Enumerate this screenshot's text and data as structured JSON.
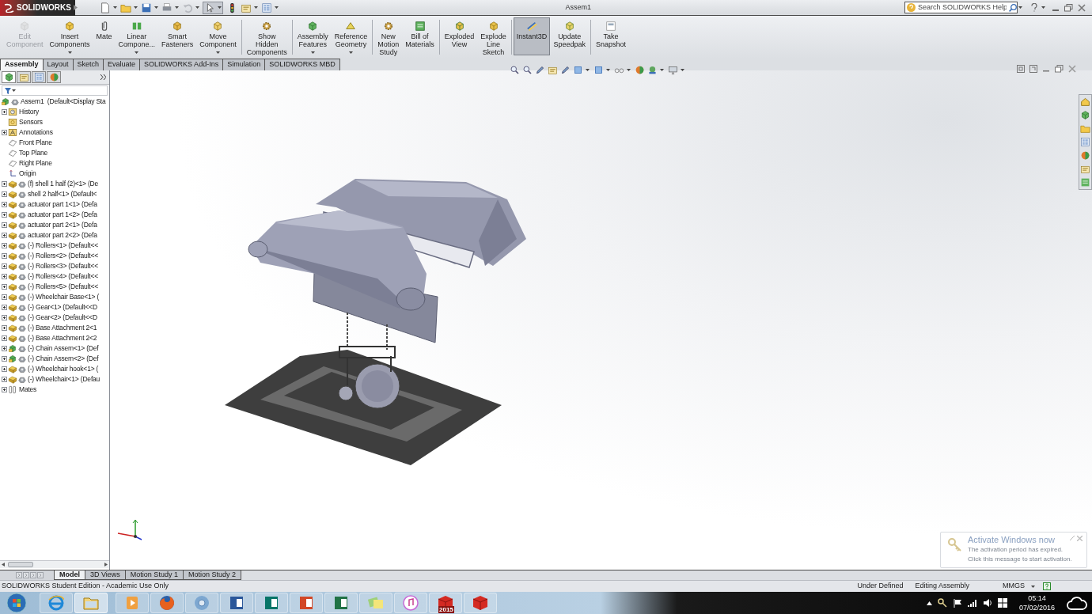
{
  "app": {
    "logo": "SOLIDWORKS",
    "title": "Assem1"
  },
  "search": {
    "placeholder": "Search SOLIDWORKS Help"
  },
  "commands": [
    {
      "lines": [
        "Edit",
        "Component"
      ],
      "disabled": true,
      "dropdown": false,
      "selected": false,
      "separator_before": false
    },
    {
      "lines": [
        "Insert",
        "Components"
      ],
      "disabled": false,
      "dropdown": true,
      "selected": false,
      "separator_before": false
    },
    {
      "lines": [
        "Mate"
      ],
      "disabled": false,
      "dropdown": false,
      "selected": false,
      "separator_before": false
    },
    {
      "lines": [
        "Linear",
        "Compone..."
      ],
      "disabled": false,
      "dropdown": true,
      "selected": false,
      "separator_before": false
    },
    {
      "lines": [
        "Smart",
        "Fasteners"
      ],
      "disabled": false,
      "dropdown": false,
      "selected": false,
      "separator_before": false
    },
    {
      "lines": [
        "Move",
        "Component"
      ],
      "disabled": false,
      "dropdown": true,
      "selected": false,
      "separator_before": false
    },
    {
      "lines": [
        "Show",
        "Hidden",
        "Components"
      ],
      "disabled": false,
      "dropdown": false,
      "selected": false,
      "separator_before": true
    },
    {
      "lines": [
        "Assembly",
        "Features"
      ],
      "disabled": false,
      "dropdown": true,
      "selected": false,
      "separator_before": true
    },
    {
      "lines": [
        "Reference",
        "Geometry"
      ],
      "disabled": false,
      "dropdown": true,
      "selected": false,
      "separator_before": false
    },
    {
      "lines": [
        "New",
        "Motion",
        "Study"
      ],
      "disabled": false,
      "dropdown": false,
      "selected": false,
      "separator_before": true
    },
    {
      "lines": [
        "Bill of",
        "Materials"
      ],
      "disabled": false,
      "dropdown": false,
      "selected": false,
      "separator_before": false
    },
    {
      "lines": [
        "Exploded",
        "View"
      ],
      "disabled": false,
      "dropdown": false,
      "selected": false,
      "separator_before": true
    },
    {
      "lines": [
        "Explode",
        "Line",
        "Sketch"
      ],
      "disabled": false,
      "dropdown": false,
      "selected": false,
      "separator_before": false
    },
    {
      "lines": [
        "Instant3D"
      ],
      "disabled": false,
      "dropdown": false,
      "selected": true,
      "separator_before": true
    },
    {
      "lines": [
        "Update",
        "Speedpak"
      ],
      "disabled": false,
      "dropdown": false,
      "selected": false,
      "separator_before": false
    },
    {
      "lines": [
        "Take",
        "Snapshot"
      ],
      "disabled": false,
      "dropdown": false,
      "selected": false,
      "separator_before": true
    }
  ],
  "tabs": [
    {
      "label": "Assembly",
      "selected": true
    },
    {
      "label": "Layout",
      "selected": false
    },
    {
      "label": "Sketch",
      "selected": false
    },
    {
      "label": "Evaluate",
      "selected": false
    },
    {
      "label": "SOLIDWORKS Add-Ins",
      "selected": false
    },
    {
      "label": "Simulation",
      "selected": false
    },
    {
      "label": "SOLIDWORKS MBD",
      "selected": false
    }
  ],
  "tree": {
    "label": "Assem1  (Default<Display Sta",
    "kind": "assembly",
    "children": [
      {
        "label": "History",
        "kind": "history",
        "expandable": true
      },
      {
        "label": "Sensors",
        "kind": "sensors",
        "expandable": false
      },
      {
        "label": "Annotations",
        "kind": "annotations",
        "expandable": true
      },
      {
        "label": "Front Plane",
        "kind": "plane",
        "expandable": false
      },
      {
        "label": "Top Plane",
        "kind": "plane",
        "expandable": false
      },
      {
        "label": "Right Plane",
        "kind": "plane",
        "expandable": false
      },
      {
        "label": "Origin",
        "kind": "origin",
        "expandable": false
      },
      {
        "label": "(f) shell 1 half (2)<1> (De",
        "kind": "part",
        "expandable": true
      },
      {
        "label": "shell 2 half<1> (Default<",
        "kind": "part",
        "expandable": true
      },
      {
        "label": "actuator part 1<1> (Defa",
        "kind": "part",
        "expandable": true
      },
      {
        "label": "actuator part 1<2> (Defa",
        "kind": "part",
        "expandable": true
      },
      {
        "label": "actuator part 2<1> (Defa",
        "kind": "part",
        "expandable": true
      },
      {
        "label": "actuator part 2<2> (Defa",
        "kind": "part",
        "expandable": true
      },
      {
        "label": "(-) Rollers<1> (Default<<",
        "kind": "part",
        "expandable": true
      },
      {
        "label": "(-) Rollers<2> (Default<<",
        "kind": "part",
        "expandable": true
      },
      {
        "label": "(-) Rollers<3> (Default<<",
        "kind": "part",
        "expandable": true
      },
      {
        "label": "(-) Rollers<4> (Default<<",
        "kind": "part",
        "expandable": true
      },
      {
        "label": "(-) Rollers<5> (Default<<",
        "kind": "part",
        "expandable": true
      },
      {
        "label": "(-) Wheelchair Base<1> (",
        "kind": "part",
        "expandable": true
      },
      {
        "label": "(-) Gear<1> (Default<<D",
        "kind": "part",
        "expandable": true
      },
      {
        "label": "(-) Gear<2> (Default<<D",
        "kind": "part",
        "expandable": true
      },
      {
        "label": "(-) Base Attachment 2<1",
        "kind": "part",
        "expandable": true
      },
      {
        "label": "(-) Base Attachment 2<2",
        "kind": "part",
        "expandable": true
      },
      {
        "label": "(-) Chain Assem<1> (Def",
        "kind": "assembly",
        "expandable": true
      },
      {
        "label": "(-) Chain Assem<2> (Def",
        "kind": "assembly",
        "expandable": true
      },
      {
        "label": "(-) Wheelchair hook<1> (",
        "kind": "part",
        "expandable": true
      },
      {
        "label": "(-) Wheelchair<1> (Defau",
        "kind": "part",
        "expandable": true
      },
      {
        "label": "Mates",
        "kind": "mates",
        "expandable": true
      }
    ]
  },
  "bottom_tabs": [
    {
      "label": "Model",
      "selected": true
    },
    {
      "label": "3D Views",
      "selected": false
    },
    {
      "label": "Motion Study 1",
      "selected": false
    },
    {
      "label": "Motion Study 2",
      "selected": false
    }
  ],
  "status_bar": {
    "edition": "SOLIDWORKS Student Edition - Academic Use Only",
    "state": "Under Defined",
    "mode": "Editing Assembly",
    "units": "MMGS"
  },
  "notification": {
    "title": "Activate Windows now",
    "lines": [
      "The activation period has expired.",
      "Click this message to start activation."
    ]
  },
  "taskbar": {
    "apps": [
      {
        "kind": "browser",
        "selected": false
      },
      {
        "kind": "folder",
        "selected": true
      },
      {
        "kind": "media",
        "selected": false
      },
      {
        "kind": "firefox",
        "selected": false
      },
      {
        "kind": "chrome",
        "selected": false
      },
      {
        "kind": "word",
        "selected": false
      },
      {
        "kind": "publisher",
        "selected": false
      },
      {
        "kind": "powerpoint",
        "selected": false
      },
      {
        "kind": "excel",
        "selected": false
      },
      {
        "kind": "notes",
        "selected": false
      },
      {
        "kind": "music",
        "selected": false
      },
      {
        "kind": "solidworks",
        "badge": "2015",
        "selected": false
      },
      {
        "kind": "solidworks",
        "selected": false
      }
    ],
    "time": "05:14",
    "date": "07/02/2016"
  }
}
